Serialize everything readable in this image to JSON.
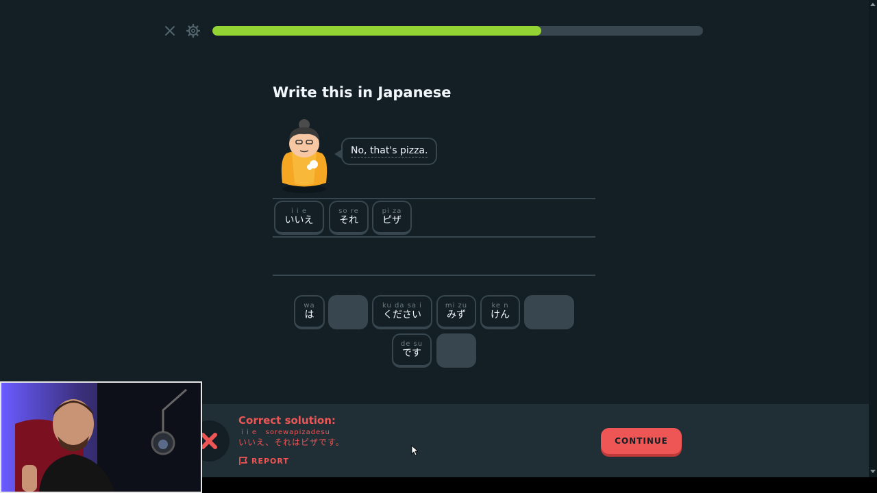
{
  "lesson": {
    "progress_percent": 67,
    "title": "Write this in Japanese",
    "prompt": "No, that's pizza."
  },
  "answer_tiles": [
    {
      "romaji": "i i e",
      "kana": "いいえ"
    },
    {
      "romaji": "so re",
      "kana": "それ"
    },
    {
      "romaji": "pi za",
      "kana": "ピザ"
    }
  ],
  "word_bank": [
    {
      "romaji": "wa",
      "kana": "は"
    },
    {
      "romaji": "",
      "kana": "",
      "used": true
    },
    {
      "romaji": "ku da sa i",
      "kana": "ください"
    },
    {
      "romaji": "mi zu",
      "kana": "みず"
    },
    {
      "romaji": "ke n",
      "kana": "けん"
    },
    {
      "romaji": "",
      "kana": "",
      "used": true
    },
    {
      "romaji": "de su",
      "kana": "です"
    },
    {
      "romaji": "",
      "kana": "",
      "used": true
    }
  ],
  "feedback": {
    "title": "Correct solution:",
    "romaji": "i i e   sorewapizadesu",
    "solution": "いいえ、それはピザです。",
    "report_label": "REPORT",
    "continue_label": "CONTINUE"
  },
  "colors": {
    "background": "#131f24",
    "progress_fill": "#93d333",
    "error_red": "#ee5555",
    "border": "#37464f"
  },
  "icons": [
    "close-icon",
    "gear-icon",
    "x-icon",
    "flag-icon"
  ]
}
